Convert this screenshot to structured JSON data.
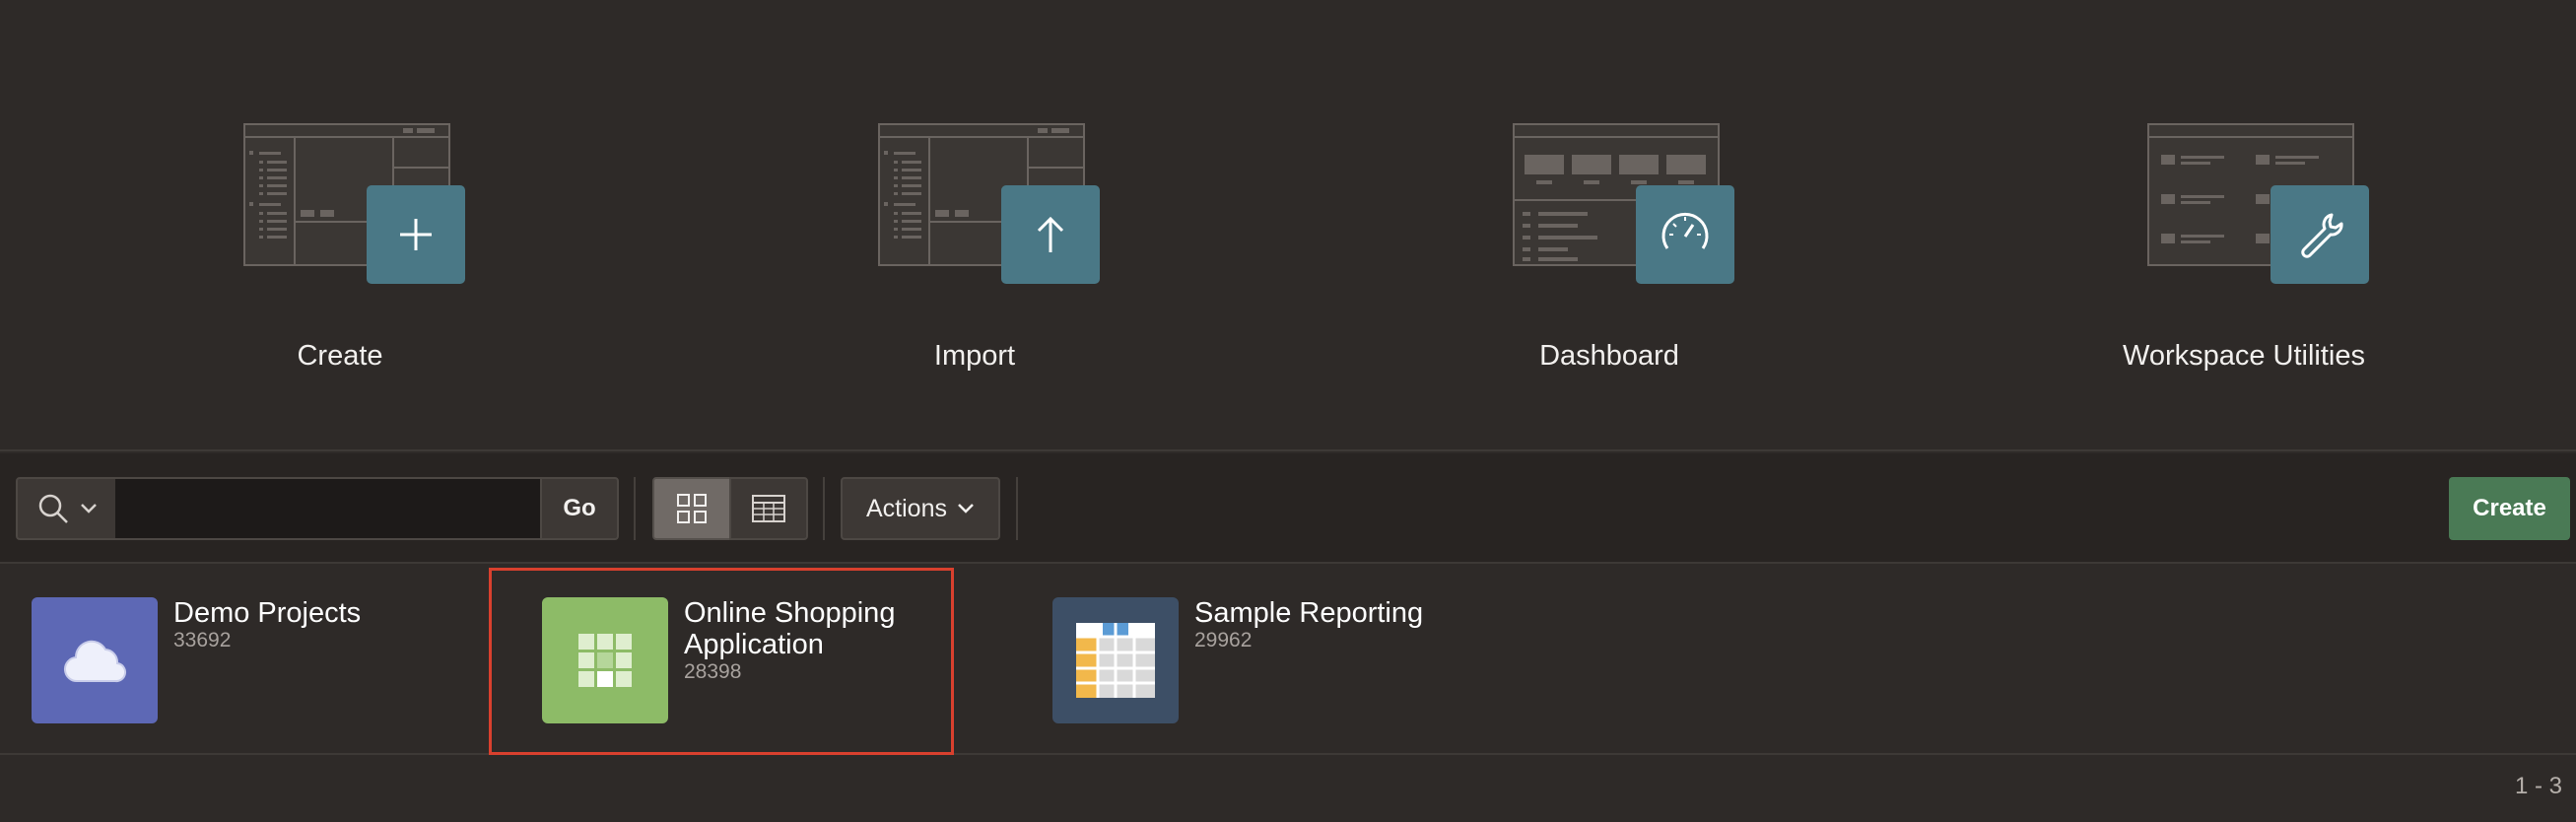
{
  "hero": {
    "tiles": [
      {
        "label": "Create",
        "icon": "plus-icon"
      },
      {
        "label": "Import",
        "icon": "arrow-up-icon"
      },
      {
        "label": "Dashboard",
        "icon": "gauge-icon"
      },
      {
        "label": "Workspace Utilities",
        "icon": "wrench-icon"
      }
    ],
    "badge_color": "#4a7886"
  },
  "toolbar": {
    "search_value": "",
    "go_label": "Go",
    "actions_label": "Actions",
    "create_label": "Create",
    "create_color": "#4a7a55"
  },
  "apps": [
    {
      "name": "Demo Projects",
      "id": "33692",
      "icon": "cloud-icon",
      "color": "#5d68b5"
    },
    {
      "name": "Online Shopping Application",
      "id": "28398",
      "icon": "grid-icon",
      "color": "#8dbb67"
    },
    {
      "name": "Sample Reporting",
      "id": "29962",
      "icon": "spreadsheet-icon",
      "color": "#3d4f66"
    }
  ],
  "pagination": "1 - 3"
}
